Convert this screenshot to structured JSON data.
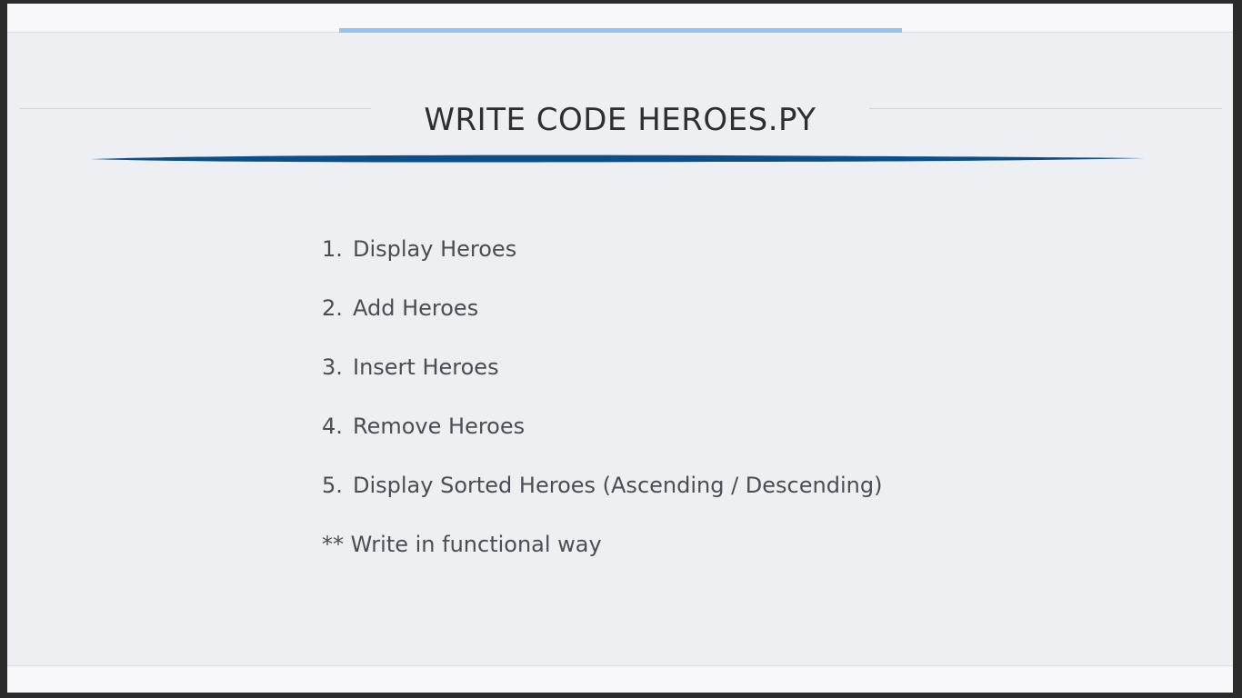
{
  "slide": {
    "title": "WRITE CODE HEROES.PY",
    "items": [
      {
        "number": "1.",
        "text": "Display Heroes"
      },
      {
        "number": "2.",
        "text": "Add Heroes"
      },
      {
        "number": "3.",
        "text": "Insert Heroes"
      },
      {
        "number": "4.",
        "text": "Remove Heroes"
      },
      {
        "number": "5.",
        "text": "Display Sorted Heroes (Ascending / Descending)"
      }
    ],
    "note": "** Write in functional way"
  },
  "colors": {
    "background": "#eeeff2",
    "frame": "#2b2b2b",
    "accent_light_blue": "#93c3f5",
    "title_underline_blue": "#0b4f8a",
    "text": "#4a4d55",
    "title_text": "#2f2f33"
  }
}
